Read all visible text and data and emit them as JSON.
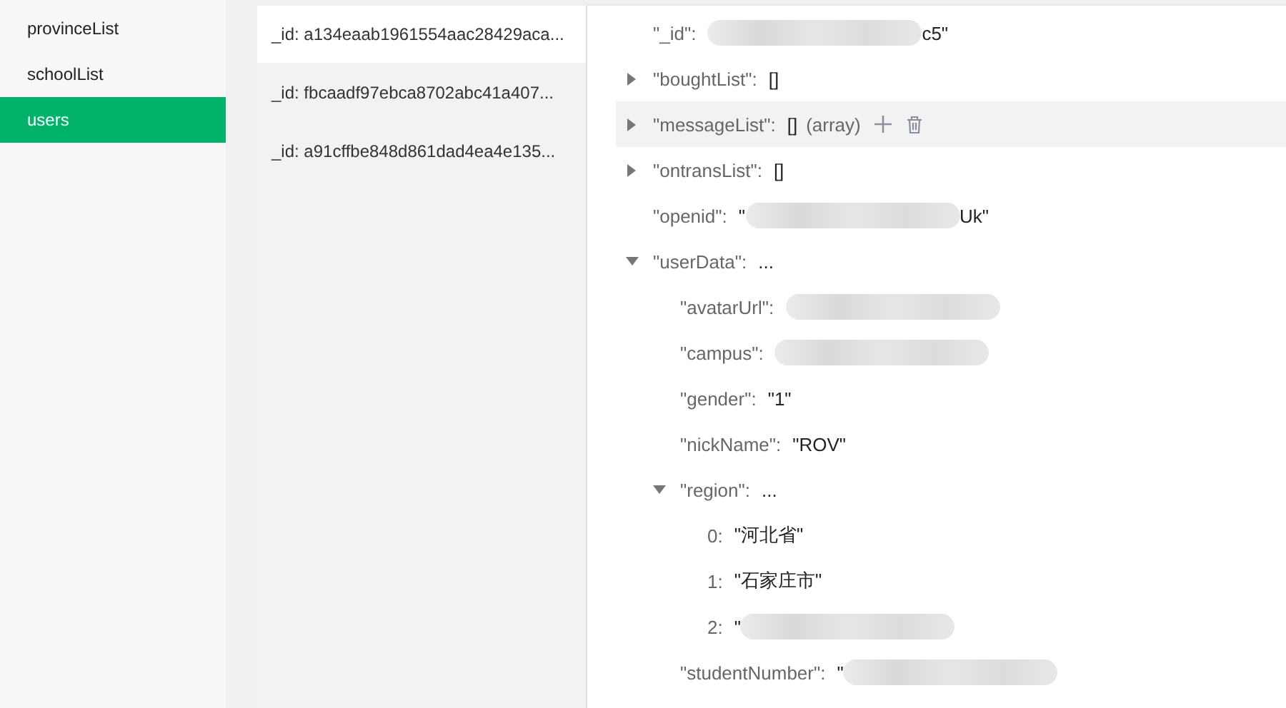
{
  "collections": [
    {
      "label": "provinceList",
      "selected": false
    },
    {
      "label": "schoolList",
      "selected": false
    },
    {
      "label": "users",
      "selected": true
    }
  ],
  "documents": [
    {
      "label": "_id: a134eaab1961554aac28429aca...",
      "selected": true
    },
    {
      "label": "_id: fbcaadf97ebca8702abc41a407...",
      "selected": false
    },
    {
      "label": "_id: a91cffbe848d861dad4ea4e135...",
      "selected": false
    }
  ],
  "fields": [
    {
      "key": "\"_id\":",
      "kind": "leaf",
      "redacted": true,
      "value_end": "c5\""
    },
    {
      "key": "\"boughtList\":",
      "kind": "branch",
      "expanded": false,
      "value": "[]"
    },
    {
      "key": "\"messageList\":",
      "kind": "branch",
      "expanded": false,
      "value": "[]",
      "hint": "(array)",
      "highlighted": true
    },
    {
      "key": "\"ontransList\":",
      "kind": "branch",
      "expanded": false,
      "value": "[]"
    },
    {
      "key": "\"openid\":",
      "kind": "leaf",
      "value_start": "\"",
      "redacted": true,
      "value_end": "Uk\""
    },
    {
      "key": "\"userData\":",
      "kind": "branch",
      "expanded": true,
      "value": "...",
      "children": [
        {
          "key": "\"avatarUrl\":",
          "kind": "leaf",
          "redacted": true
        },
        {
          "key": "\"campus\":",
          "kind": "leaf",
          "redacted": true
        },
        {
          "key": "\"gender\":",
          "kind": "leaf",
          "value": "\"1\""
        },
        {
          "key": "\"nickName\":",
          "kind": "leaf",
          "value": "\"ROV\""
        },
        {
          "key": "\"region\":",
          "kind": "branch",
          "expanded": true,
          "value": "...",
          "children": [
            {
              "key": "0:",
              "kind": "leaf",
              "value": "\"河北省\""
            },
            {
              "key": "1:",
              "kind": "leaf",
              "value": "\"石家庄市\""
            },
            {
              "key": "2:",
              "kind": "leaf",
              "value_start": "\"",
              "redacted": true
            }
          ]
        },
        {
          "key": "\"studentNumber\":",
          "kind": "leaf",
          "value_start": "\"",
          "redacted": true
        }
      ]
    }
  ]
}
